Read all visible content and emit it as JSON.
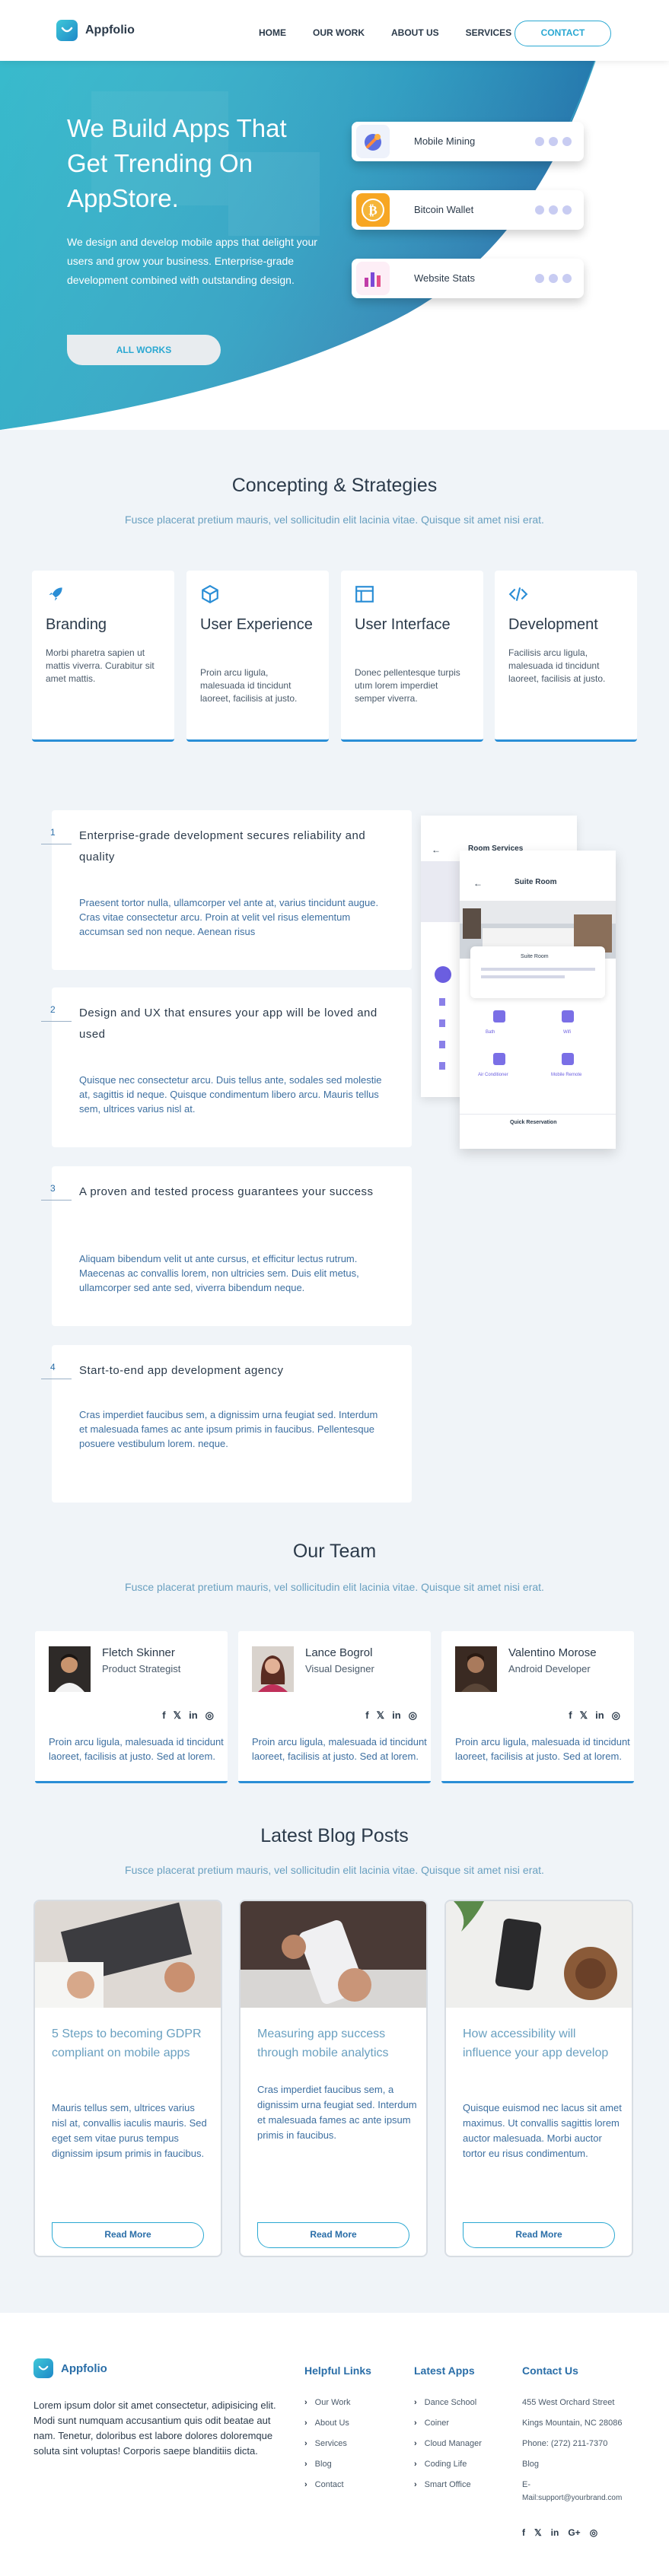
{
  "nav": {
    "brand": "Appfolio",
    "links": [
      "HOME",
      "OUR WORK",
      "ABOUT US",
      "SERVICES"
    ],
    "contact": "CONTACT"
  },
  "hero": {
    "title": "We Build Apps That Get Trending On AppStore.",
    "text": "We design and develop mobile apps that delight your users and grow your business. Enterprise-grade development combined with outstanding design.",
    "button": "ALL WORKS",
    "apps": [
      {
        "name": "Mobile Mining",
        "icon": "mining-icon"
      },
      {
        "name": "Bitcoin Wallet",
        "icon": "bitcoin-icon"
      },
      {
        "name": "Website Stats",
        "icon": "stats-icon"
      }
    ]
  },
  "concepting": {
    "title": "Concepting & Strategies",
    "subtitle": "Fusce placerat pretium mauris, vel sollicitudin elit lacinia vitae. Quisque sit amet nisi erat.",
    "features": [
      {
        "title": "Branding",
        "text": "Morbi pharetra sapien ut mattis viverra. Curabitur sit amet mattis.",
        "icon": "rocket-icon"
      },
      {
        "title": "User Experience",
        "text": "Proin arcu ligula, malesuada id tincidunt laoreet, facilisis at justo.",
        "icon": "cube-icon"
      },
      {
        "title": "User Interface",
        "text": "Donec pellentesque turpis utım lorem imperdiet semper viverra.",
        "icon": "layout-icon"
      },
      {
        "title": "Development",
        "text": "Facilisis arcu ligula, malesuada id tincidunt laoreet, facilisis at justo.",
        "icon": "code-icon"
      }
    ]
  },
  "process": [
    {
      "num": "1",
      "title": "Enterprise-grade development secures reliability and quality",
      "text": "Praesent tortor nulla, ullamcorper vel ante at, varius tincidunt augue. Cras vitae consectetur arcu. Proin at velit vel risus elementum accumsan sed non neque. Aenean risus"
    },
    {
      "num": "2",
      "title": "Design and UX that ensures your app will be loved and used",
      "text": "Quisque nec consectetur arcu. Duis tellus ante, sodales sed molestie at, sagittis id neque. Quisque condimentum libero arcu. Mauris tellus sem, ultrices varius nisl at."
    },
    {
      "num": "3",
      "title": "A proven and tested process guarantees your success",
      "text": "Aliquam bibendum velit ut ante cursus, et efficitur lectus rutrum. Maecenas ac convallis lorem, non ultricies sem. Duis elit metus, ullamcorper sed ante sed, viverra bibendum neque."
    },
    {
      "num": "4",
      "title": "Start-to-end app development agency",
      "text": "Cras imperdiet faucibus sem, a dignissim urna feugiat sed. Interdum et malesuada fames ac ante ipsum primis in faucibus. Pellentesque posuere vestibulum lorem. neque."
    }
  ],
  "mockup": {
    "back_title": "Room Services",
    "front_title": "Suite Room",
    "section_label": "Suite Room",
    "action": "Quick Reservation",
    "tiles": [
      "Bath",
      "Wifi",
      "Air Conditioner",
      "Mobile Remote"
    ]
  },
  "team": {
    "title": "Our Team",
    "subtitle": "Fusce placerat pretium mauris, vel sollicitudin elit lacinia vitae. Quisque sit amet nisi erat.",
    "members": [
      {
        "name": "Fletch Skinner",
        "role": "Product Strategist",
        "text": "Proin arcu ligula, malesuada id tincidunt laoreet, facilisis at justo. Sed at lorem."
      },
      {
        "name": "Lance Bogrol",
        "role": "Visual Designer",
        "text": "Proin arcu ligula, malesuada id tincidunt laoreet, facilisis at justo. Sed at lorem."
      },
      {
        "name": "Valentino Morose",
        "role": "Android Developer",
        "text": "Proin arcu ligula, malesuada id tincidunt laoreet, facilisis at justo. Sed at lorem."
      }
    ],
    "social_glyphs": [
      "f",
      "𝕏",
      "in",
      "◎"
    ]
  },
  "blog": {
    "title": "Latest Blog Posts",
    "subtitle": "Fusce placerat pretium mauris, vel sollicitudin elit lacinia vitae. Quisque sit amet nisi erat.",
    "posts": [
      {
        "title": "5 Steps to becoming GDPR compliant on mobile apps",
        "text": "Mauris tellus sem, ultrices varius nisl at, convallis iaculis mauris. Sed eget sem vitae purus tempus dignissim ipsum primis in faucibus.",
        "button": "Read More"
      },
      {
        "title": "Measuring app success through mobile analytics",
        "text": "Cras imperdiet faucibus sem, a dignissim urna feugiat sed. Interdum et malesuada fames ac ante ipsum primis in faucibus.",
        "button": "Read More"
      },
      {
        "title": "How accessibility will influence your app develop",
        "text": "Quisque euismod nec lacus sit amet maximus. Ut convallis sagittis lorem auctor malesuada. Morbi auctor tortor eu risus condimentum.",
        "button": "Read More"
      }
    ]
  },
  "footer": {
    "brand": "Appfolio",
    "about": "Lorem ipsum dolor sit amet consectetur, adipisicing elit. Modi sunt numquam accusantium quis odit beatae aut nam. Tenetur, doloribus est labore dolores doloremque soluta sint voluptas! Corporis saepe blanditiis dicta.",
    "helpful_title": "Helpful Links",
    "helpful": [
      "Our Work",
      "About Us",
      "Services",
      "Blog",
      "Contact"
    ],
    "apps_title": "Latest Apps",
    "apps": [
      "Dance School",
      "Coiner",
      "Cloud Manager",
      "Coding Life",
      "Smart Office"
    ],
    "contact_title": "Contact Us",
    "contact": [
      "455 West Orchard Street",
      "Kings Mountain, NC 28086",
      "Phone: (272) 211-7370",
      "Blog",
      "E-",
      "Mail:support@yourbrand.com"
    ],
    "social_glyphs": [
      "f",
      "𝕏",
      "in",
      "G+",
      "◎"
    ]
  }
}
